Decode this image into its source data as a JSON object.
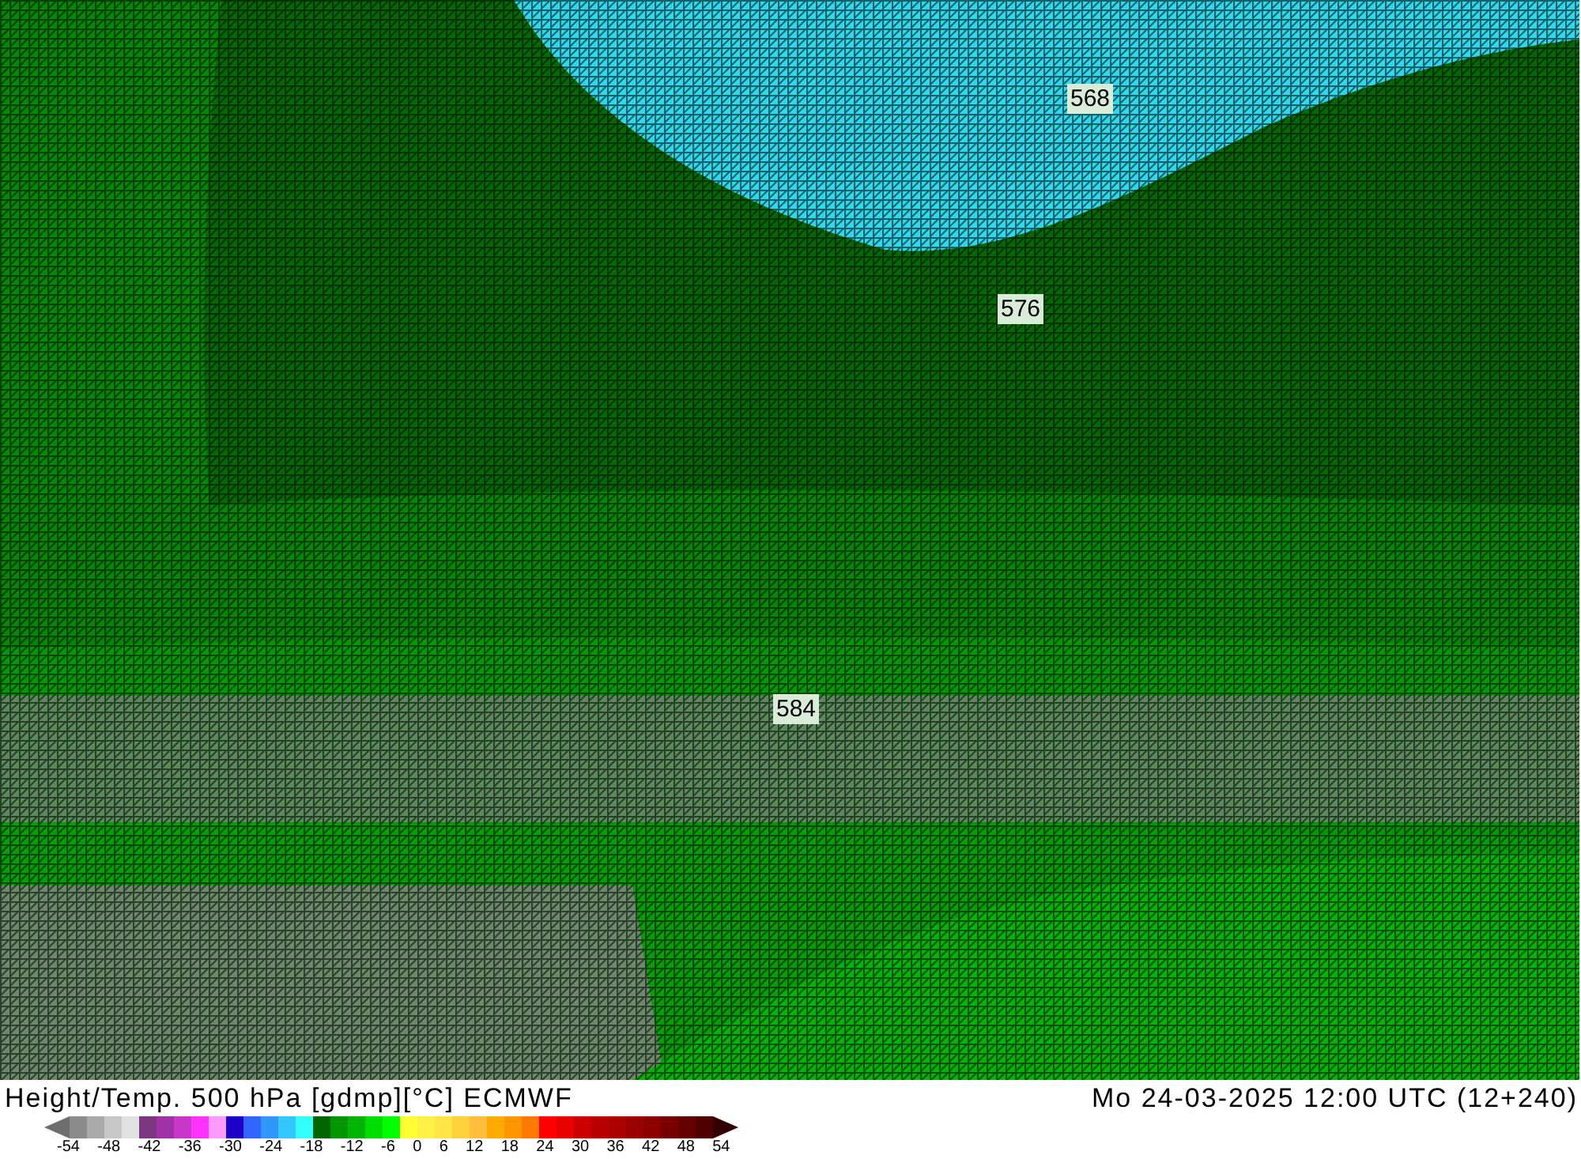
{
  "map": {
    "contour_labels": [
      {
        "text": "568"
      },
      {
        "text": "576"
      },
      {
        "text": "584"
      }
    ]
  },
  "title": "Height/Temp. 500 hPa [gdmp][°C] ECMWF",
  "valid_time": "Mo 24-03-2025 12:00 UTC (12+240)",
  "legend": {
    "swatches": [
      {
        "color": "#8c8c8c"
      },
      {
        "color": "#aaaaaa"
      },
      {
        "color": "#c8c8c8"
      },
      {
        "color": "#e1e1e1"
      },
      {
        "color": "#7d3782"
      },
      {
        "color": "#a032a8"
      },
      {
        "color": "#c837c8"
      },
      {
        "color": "#ff32ff"
      },
      {
        "color": "#ff9bff"
      },
      {
        "color": "#1e00c8"
      },
      {
        "color": "#3264ff"
      },
      {
        "color": "#3296ff"
      },
      {
        "color": "#32c8ff"
      },
      {
        "color": "#32ffff"
      },
      {
        "color": "#006400"
      },
      {
        "color": "#009600"
      },
      {
        "color": "#00b400"
      },
      {
        "color": "#00dc00"
      },
      {
        "color": "#00ff00"
      },
      {
        "color": "#ffff32"
      },
      {
        "color": "#fff046"
      },
      {
        "color": "#ffe646"
      },
      {
        "color": "#ffd23c"
      },
      {
        "color": "#ffbe3c"
      },
      {
        "color": "#ffaa00"
      },
      {
        "color": "#ff9600"
      },
      {
        "color": "#ff7800"
      },
      {
        "color": "#ff0000"
      },
      {
        "color": "#e60000"
      },
      {
        "color": "#cd0000"
      },
      {
        "color": "#b90000"
      },
      {
        "color": "#aa0000"
      },
      {
        "color": "#9b0000"
      },
      {
        "color": "#8c0000"
      },
      {
        "color": "#780000"
      },
      {
        "color": "#640000"
      },
      {
        "color": "#500000"
      }
    ],
    "ticks": [
      "-54",
      "-48",
      "-42",
      "-36",
      "-30",
      "-24",
      "-18",
      "-12",
      "-6",
      "0",
      "6",
      "12",
      "18",
      "24",
      "30",
      "36",
      "42",
      "48",
      "54"
    ]
  }
}
